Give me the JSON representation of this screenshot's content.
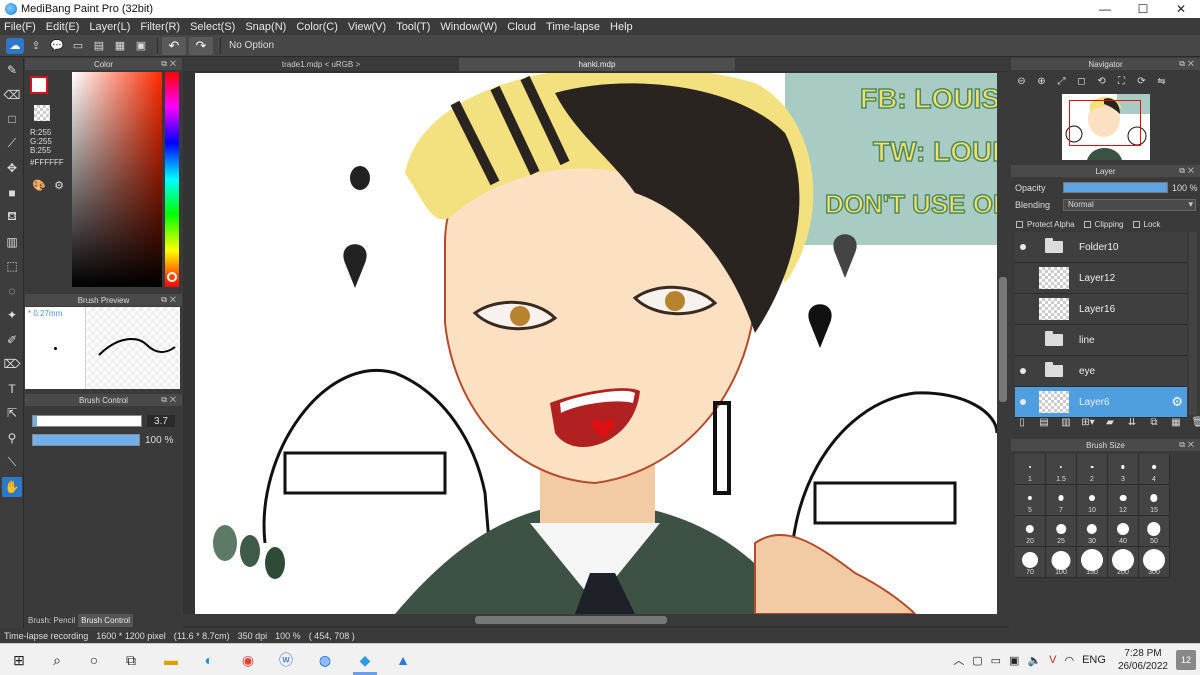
{
  "window": {
    "title": "MediBang Paint Pro (32bit)",
    "minimize": "—",
    "maximize": "☐",
    "close": "✕"
  },
  "menu": [
    "File(F)",
    "Edit(E)",
    "Layer(L)",
    "Filter(R)",
    "Select(S)",
    "Snap(N)",
    "Color(C)",
    "View(V)",
    "Tool(T)",
    "Window(W)",
    "Cloud",
    "Time-lapse",
    "Help"
  ],
  "toolbar": {
    "option_text": "No Option",
    "undo": "↶",
    "redo": "↷"
  },
  "color_panel": {
    "title": "Color",
    "r": "R:255",
    "g": "G:255",
    "b": "B:255",
    "hex": "#FFFFFF",
    "fg_color": "#ffffff"
  },
  "brush_preview": {
    "title": "Brush Preview",
    "size": "* 0.27mm"
  },
  "brush_control": {
    "title": "Brush Control",
    "size_value": "3.7",
    "opacity_value": "100 %",
    "size_fraction": 0.04,
    "opacity_fraction": 1.0
  },
  "left_tabs": {
    "pencil": "Brush: Pencil",
    "control": "Brush Control"
  },
  "documents": {
    "tab1": "trade1.mdp < uRGB >",
    "tab2": "hanki.mdp"
  },
  "artwork_text": {
    "line1": "FB: LOUIS V",
    "line2": "TW: LOUIS_",
    "line3": "DON'T USE OR"
  },
  "navigator": {
    "title": "Navigator"
  },
  "layer_panel": {
    "title": "Layer",
    "opacity_label": "Opacity",
    "opacity_value": "100 %",
    "blending_label": "Blending",
    "blending_value": "Normal",
    "protect_alpha": "Protect Alpha",
    "clipping": "Clipping",
    "lock": "Lock",
    "layers": [
      {
        "name": "Folder10",
        "type": "folder",
        "visible": true,
        "selected": false
      },
      {
        "name": "Layer12",
        "type": "layer",
        "visible": false,
        "selected": false
      },
      {
        "name": "Layer16",
        "type": "layer",
        "visible": false,
        "selected": false
      },
      {
        "name": "line",
        "type": "folder",
        "visible": false,
        "selected": false
      },
      {
        "name": "eye",
        "type": "folder",
        "visible": true,
        "selected": false
      },
      {
        "name": "Layer6",
        "type": "layer",
        "visible": true,
        "selected": true
      }
    ]
  },
  "brush_size_panel": {
    "title": "Brush Size",
    "sizes": [
      "1",
      "1.5",
      "2",
      "3",
      "4",
      "5",
      "7",
      "10",
      "12",
      "15",
      "20",
      "25",
      "30",
      "40",
      "50",
      "70",
      "100",
      "150",
      "200",
      "300"
    ]
  },
  "status": {
    "recording": "Time-lapse recording",
    "size": "1600 * 1200 pixel",
    "physical": "(11.6 * 8.7cm)",
    "dpi": "350 dpi",
    "zoom": "100 %",
    "coords": "( 454, 708 )"
  },
  "taskbar": {
    "language": "ENG",
    "time": "7:28 PM",
    "date": "26/06/2022",
    "notifications": "12"
  }
}
